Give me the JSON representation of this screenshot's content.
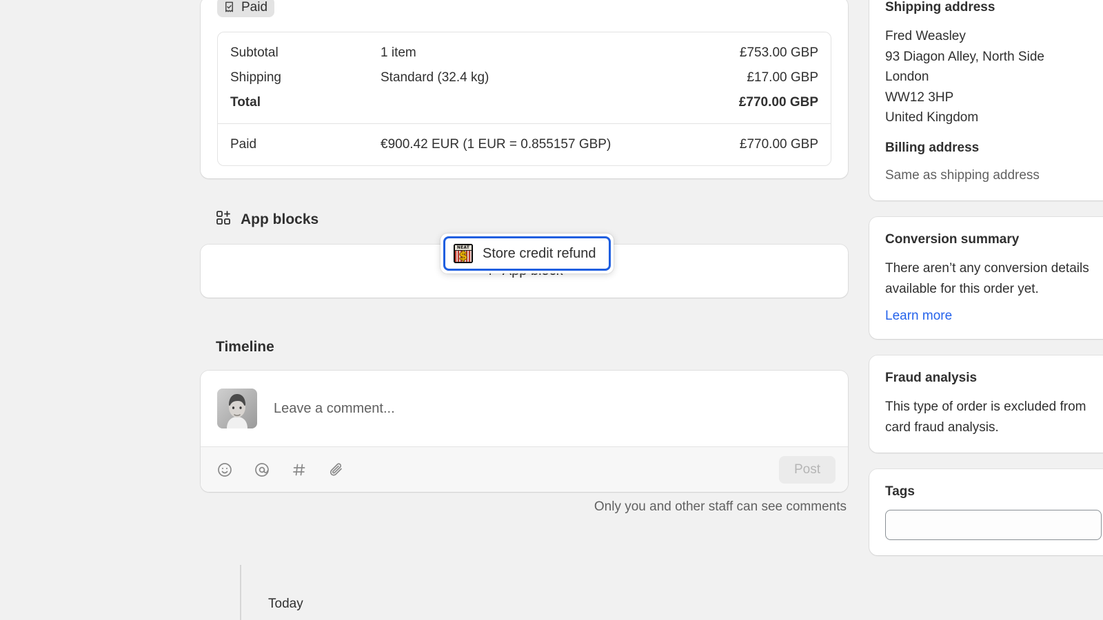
{
  "order": {
    "status_badge": {
      "label": "Paid",
      "icon": "receipt-check-icon"
    },
    "totals": {
      "rows": [
        {
          "label": "Subtotal",
          "desc": "1 item",
          "amount": "£753.00 GBP",
          "bold": false
        },
        {
          "label": "Shipping",
          "desc": "Standard (32.4 kg)",
          "amount": "£17.00 GBP",
          "bold": false
        },
        {
          "label": "Total",
          "desc": "",
          "amount": "£770.00 GBP",
          "bold": true
        }
      ],
      "paid_row": {
        "label": "Paid",
        "desc": "€900.42 EUR (1 EUR = 0.855157 GBP)",
        "amount": "£770.00 GBP"
      }
    }
  },
  "app_blocks": {
    "heading": "App blocks",
    "heading_icon": "app-blocks-grid-icon",
    "add_button": {
      "plus": "+",
      "label": "App block"
    },
    "popover": {
      "label": "Store credit refund",
      "icon": "neat-store-credit-app-icon",
      "highlight_color": "#1f5fe0"
    }
  },
  "timeline": {
    "heading": "Timeline",
    "comment": {
      "avatar_name": "staff-avatar",
      "placeholder": "Leave a comment...",
      "tools": [
        {
          "name": "emoji-icon",
          "glyph": "☺"
        },
        {
          "name": "mention-icon",
          "glyph": "@"
        },
        {
          "name": "hashtag-icon",
          "glyph": "#"
        },
        {
          "name": "attachment-icon",
          "glyph": "📎"
        }
      ],
      "post_label": "Post",
      "post_disabled": true
    },
    "visibility_note": "Only you and other staff can see comments",
    "day_label": "Today"
  },
  "sidebar": {
    "addresses": {
      "shipping_title": "Shipping address",
      "shipping_lines": [
        "Fred Weasley",
        "93 Diagon Alley, North Side",
        "London",
        "WW12 3HP",
        "United Kingdom"
      ],
      "billing_title": "Billing address",
      "billing_text": "Same as shipping address"
    },
    "conversion": {
      "title": "Conversion summary",
      "body": "There aren’t any conversion details available for this order yet.",
      "link": "Learn more"
    },
    "fraud": {
      "title": "Fraud analysis",
      "body": "This type of order is excluded from card fraud analysis."
    },
    "tags": {
      "title": "Tags",
      "value": "",
      "placeholder": ""
    }
  },
  "colors": {
    "page_bg": "#f1f1f1",
    "card_bg": "#ffffff",
    "text": "#303030",
    "muted": "#616161",
    "link": "#2563eb",
    "border": "#e3e3e3",
    "focus_ring": "#1f5fe0"
  }
}
